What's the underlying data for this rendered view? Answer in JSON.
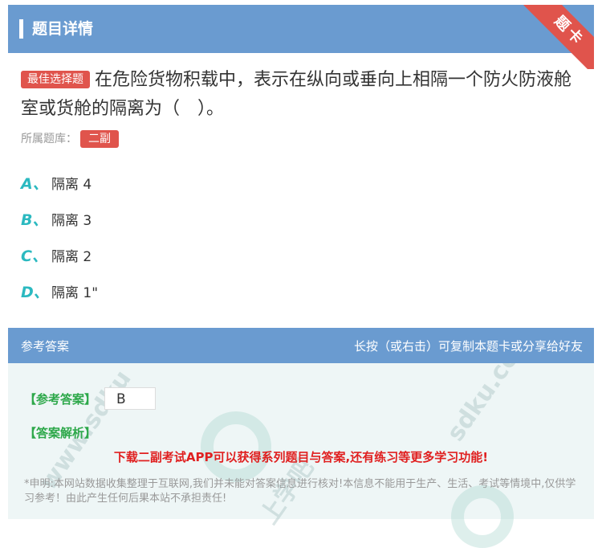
{
  "header": {
    "title": "题目详情",
    "ribbon": "题卡"
  },
  "question": {
    "badge": "最佳选择题",
    "text": "在危险货物积载中，表示在纵向或垂向上相隔一个防火防液舱 室或货舱的隔离为（　）。",
    "bank_label": "所属题库：",
    "bank_tag": "二副"
  },
  "options": [
    {
      "letter": "A、",
      "text": "隔离 4"
    },
    {
      "letter": "B、",
      "text": "隔离 3"
    },
    {
      "letter": "C、",
      "text": "隔离 2"
    },
    {
      "letter": "D、",
      "text": "隔离 1\""
    }
  ],
  "answer": {
    "head_left": "参考答案",
    "head_right": "长按（或右击）可复制本题卡或分享给好友",
    "ref_label": "【参考答案】",
    "ref_value": "B",
    "analysis_label": "【答案解析】",
    "promo": "下载二副考试APP可以获得系列题目与答案,还有练习等更多学习功能!",
    "disclaimer": "*申明:本网站数据收集整理于互联网,我们并未能对答案信息进行核对!本信息不能用于生产、生活、考试等情境中,仅供学习参考！由此产生任何后果本站不承担责任!"
  },
  "watermark": "上学吧 www.sdku.com"
}
